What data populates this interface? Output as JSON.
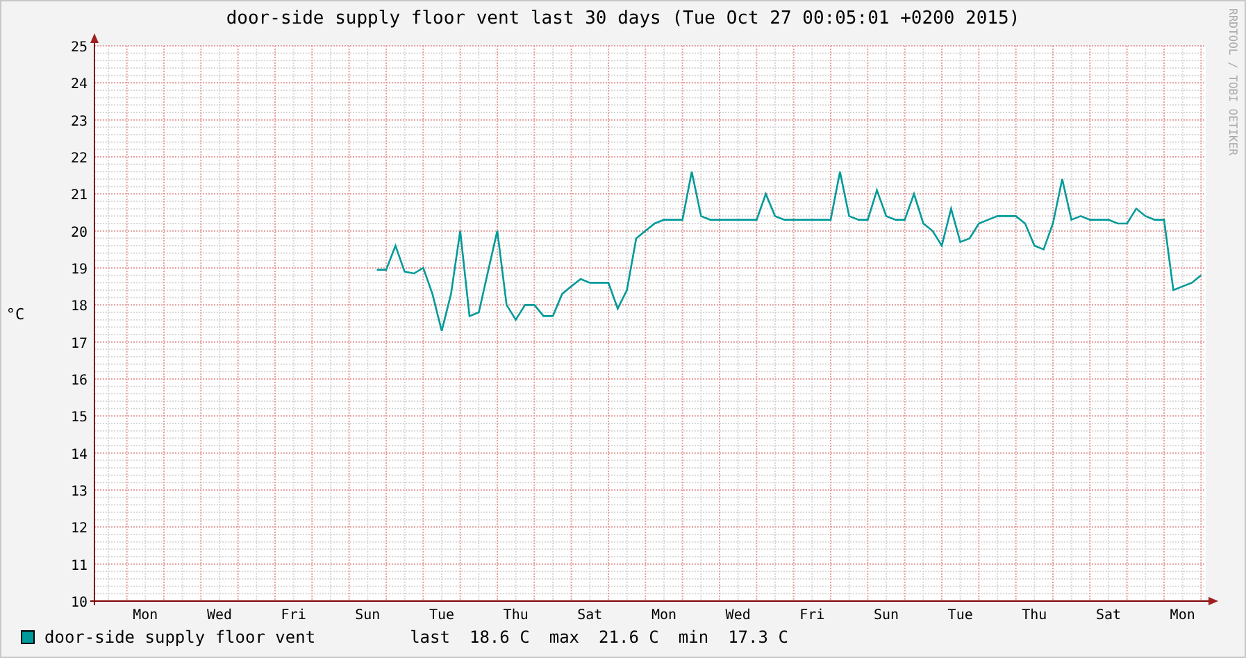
{
  "side_text": "RRDTOOL / TOBI OETIKER",
  "chart": {
    "chart_data": {
      "type": "line",
      "title": "door-side supply floor vent last 30 days (Tue Oct 27 00:05:01 +0200 2015)",
      "ylabel": "°C",
      "grid": true,
      "ylim": [
        10,
        25
      ],
      "yticks": [
        10,
        11,
        12,
        13,
        14,
        15,
        16,
        17,
        18,
        19,
        20,
        21,
        22,
        23,
        24,
        25
      ],
      "categories": [
        null,
        null,
        null,
        null,
        null,
        "Mon",
        null,
        null,
        null,
        null,
        null,
        null,
        null,
        "Wed",
        null,
        null,
        null,
        null,
        null,
        null,
        null,
        "Fri",
        null,
        null,
        null,
        null,
        null,
        null,
        null,
        "Sun",
        null,
        null,
        null,
        null,
        null,
        null,
        null,
        "Tue",
        null,
        null,
        null,
        null,
        null,
        null,
        null,
        "Thu",
        null,
        null,
        null,
        null,
        null,
        null,
        null,
        "Sat",
        null,
        null,
        null,
        null,
        null,
        null,
        null,
        "Mon",
        null,
        null,
        null,
        null,
        null,
        null,
        null,
        "Wed",
        null,
        null,
        null,
        null,
        null,
        null,
        null,
        "Fri",
        null,
        null,
        null,
        null,
        null,
        null,
        null,
        "Sun",
        null,
        null,
        null,
        null,
        null,
        null,
        null,
        "Tue",
        null,
        null,
        null,
        null,
        null,
        null,
        null,
        "Thu",
        null,
        null,
        null,
        null,
        null,
        null,
        null,
        "Sat",
        null,
        null,
        null,
        null,
        null,
        null,
        null,
        "Mon",
        null,
        null
      ],
      "series": [
        {
          "name": "door-side supply floor vent",
          "color": "#009a9a",
          "values": [
            null,
            null,
            null,
            null,
            null,
            null,
            null,
            null,
            null,
            null,
            null,
            null,
            null,
            null,
            null,
            null,
            null,
            null,
            null,
            null,
            null,
            null,
            null,
            null,
            null,
            null,
            null,
            null,
            null,
            null,
            18.95,
            18.95,
            19.6,
            18.9,
            18.85,
            19.0,
            18.3,
            17.3,
            18.3,
            20.0,
            17.7,
            17.8,
            18.9,
            20.0,
            18.0,
            17.6,
            18.0,
            18.0,
            17.7,
            17.7,
            18.3,
            18.5,
            18.7,
            18.6,
            18.6,
            18.6,
            17.9,
            18.4,
            19.8,
            20.0,
            20.2,
            20.3,
            20.3,
            20.3,
            21.6,
            20.4,
            20.3,
            20.3,
            20.3,
            20.3,
            20.3,
            20.3,
            21.0,
            20.4,
            20.3,
            20.3,
            20.3,
            20.3,
            20.3,
            20.3,
            21.6,
            20.4,
            20.3,
            20.3,
            21.1,
            20.4,
            20.3,
            20.3,
            21.0,
            20.2,
            20.0,
            19.6,
            20.6,
            19.7,
            19.8,
            20.2,
            20.3,
            20.4,
            20.4,
            20.4,
            20.2,
            19.6,
            19.5,
            20.2,
            21.4,
            20.3,
            20.4,
            20.3,
            20.3,
            20.3,
            20.2,
            20.2,
            20.6,
            20.4,
            20.3,
            20.3,
            18.4,
            18.5,
            18.6,
            18.8
          ]
        }
      ]
    }
  },
  "legend": {
    "stats": [
      {
        "label": "last",
        "value": "18.6 C"
      },
      {
        "label": "max",
        "value": "21.6 C"
      },
      {
        "label": "min",
        "value": "17.3 C"
      }
    ]
  }
}
